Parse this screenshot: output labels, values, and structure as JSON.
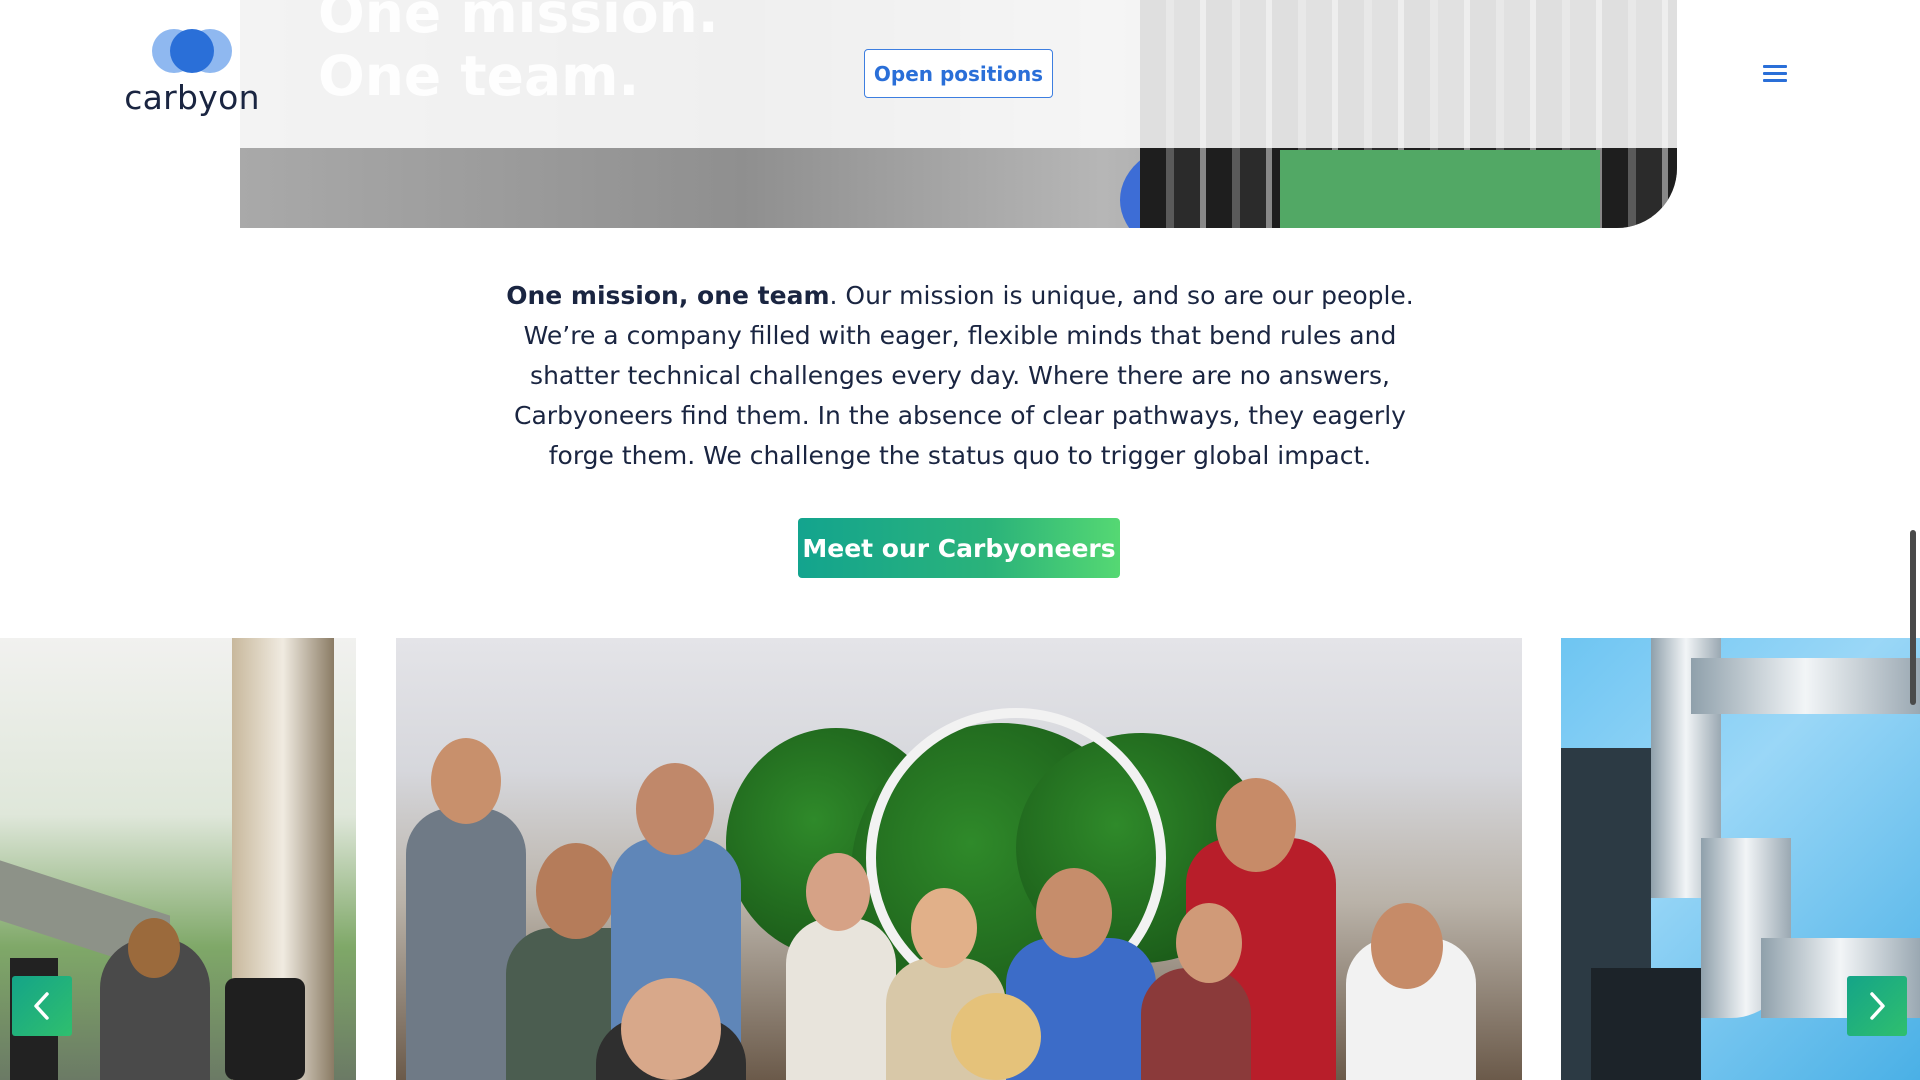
{
  "brand": {
    "logo_text": "carbyon",
    "colors": {
      "primary_blue": "#2a6fd8",
      "navy": "#1a2541",
      "teal": "#13a48e",
      "green": "#55d873"
    }
  },
  "hero": {
    "title": "One mission.\nOne team."
  },
  "header": {
    "open_positions_label": "Open positions",
    "menu_icon": "hamburger-menu-icon"
  },
  "mission": {
    "lead": "One mission, one team",
    "body": ". Our mission is unique, and so are our people. We’re a company filled with eager, flexible minds that bend rules and shatter technical challenges every day. Where there are no answers, Carbyoneers find them. In the absence of clear pathways, they eagerly forge them. We challenge the status quo to trigger global impact."
  },
  "cta": {
    "meet_label": "Meet our Carbyoneers"
  },
  "carousel": {
    "prev_icon": "chevron-left-icon",
    "next_icon": "chevron-right-icon"
  }
}
